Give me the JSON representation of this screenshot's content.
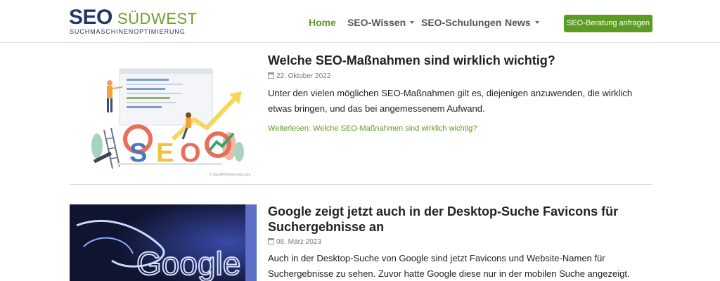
{
  "header": {
    "logo": {
      "seo": "SEO",
      "suedwest": "SÜDWEST",
      "tagline": "SUCHMASCHINENOPTIMIERUNG"
    },
    "nav": [
      {
        "label": "Home",
        "active": true,
        "dropdown": false
      },
      {
        "label": "SEO-Wissen",
        "active": false,
        "dropdown": true
      },
      {
        "label": "SEO-Schulungen",
        "active": false,
        "dropdown": false
      },
      {
        "label": "News",
        "active": false,
        "dropdown": true
      }
    ],
    "cta_label": "SEO-Beratung anfragen"
  },
  "posts": [
    {
      "title": "Welche SEO-Maßnahmen sind wirklich wichtig?",
      "date": "22. Oktober 2022",
      "excerpt": "Unter den vielen möglichen SEO-Maßnahmen gilt es, diejenigen anzuwenden, die wirklich etwas bringen, und das bei angemessenem Aufwand.",
      "read_more": "Weiterlesen: Welche SEO-Maßnahmen sind wirklich wichtig?",
      "image_letters": [
        "S",
        "E",
        "O"
      ],
      "image_credit": "© StockPhotoSecrets.com"
    },
    {
      "title": "Google zeigt jetzt auch in der Desktop-Suche Favicons für Suchergebnisse an",
      "date": "08. März 2023",
      "excerpt": "Auch in der Desktop-Suche von Google sind jetzt Favicons und Website-Namen für Suchergebnisse zu sehen. Zuvor hatte Google diese nur in der mobilen Suche angezeigt.",
      "image_text": "Google"
    }
  ],
  "colors": {
    "brand_blue": "#1f3864",
    "brand_green": "#5f9a1f",
    "cta": "#5b9c22"
  }
}
